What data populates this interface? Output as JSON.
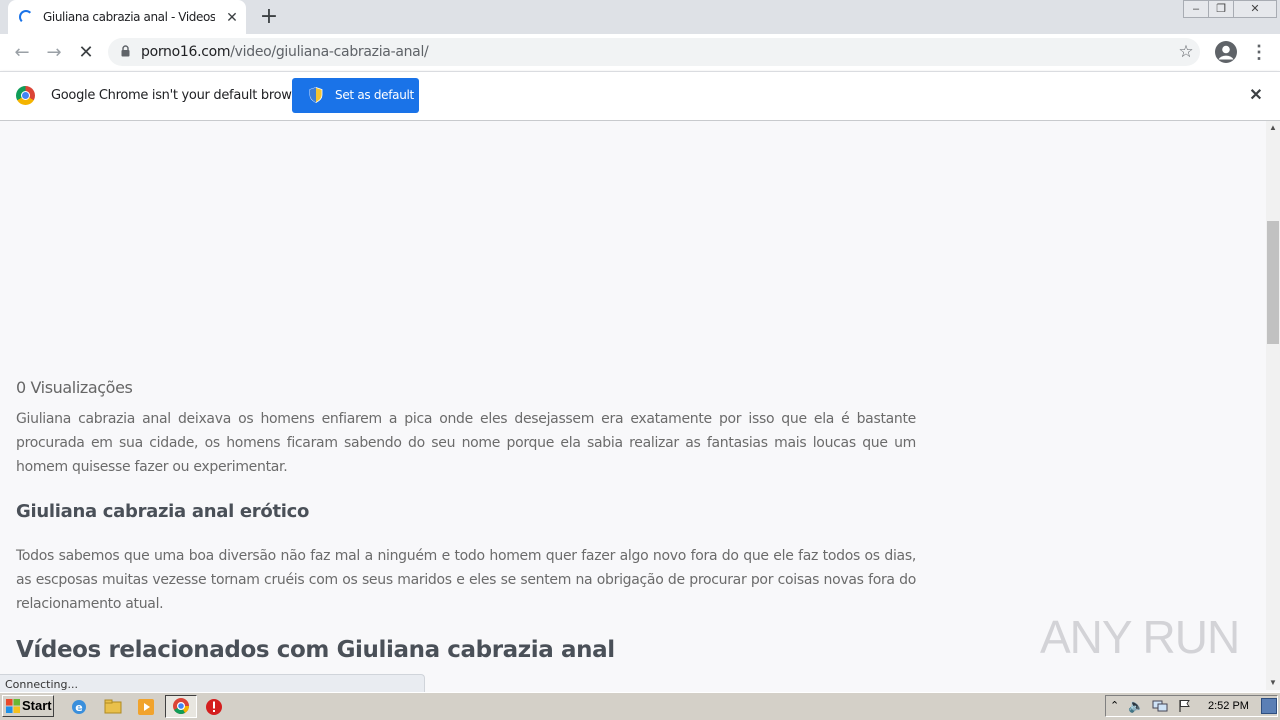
{
  "browser": {
    "tab_title": "Giuliana cabrazia anal - Videos Xxx |",
    "url_host": "porno16.com",
    "url_path": "/video/giuliana-cabrazia-anal/",
    "infobar_message": "Google Chrome isn't your default browser",
    "set_default_label": "Set as default",
    "status_text": "Connecting..."
  },
  "page": {
    "views": "0 Visualizações",
    "paragraph1": "Giuliana cabrazia anal deixava os homens enfiarem a pica onde eles desejassem era exatamente por isso que ela é bastante procurada em sua cidade, os homens ficaram sabendo do seu nome porque ela sabia realizar as fantasias mais loucas que um homem quisesse fazer ou experimentar.",
    "heading2": "Giuliana cabrazia anal erótico",
    "paragraph2": "Todos sabemos que uma boa diversão não faz mal a ninguém e todo homem quer fazer algo novo fora do que ele faz todos os dias, as escposas muitas vezesse tornam cruéis com os seus maridos e eles se sentem na obrigação de procurar por coisas novas fora do relacionamento atual.",
    "heading3": "Vídeos relacionados com Giuliana cabrazia anal"
  },
  "watermark": "ANY RUN",
  "taskbar": {
    "start_label": "Start",
    "clock": "2:52 PM",
    "icons": [
      "ie-icon",
      "explorer-icon",
      "media-player-icon",
      "chrome-icon",
      "antivirus-icon"
    ]
  },
  "colors": {
    "accent": "#1a73e8",
    "tab_strip": "#dee1e6",
    "page_bg": "#f8f8fa",
    "taskbar": "#d4d0c8"
  }
}
